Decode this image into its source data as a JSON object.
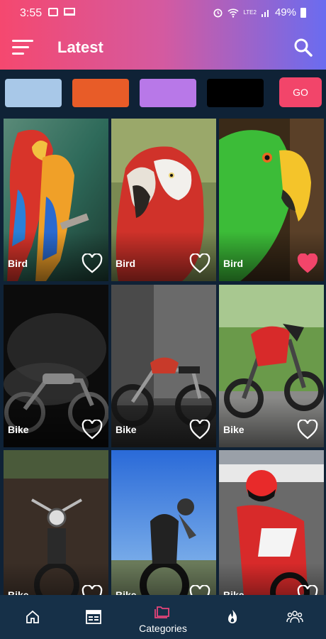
{
  "status_bar": {
    "time": "3:55",
    "battery": "49%",
    "network": "LTE2"
  },
  "header": {
    "title": "Latest"
  },
  "color_filter": {
    "swatches": [
      "#a8c8e8",
      "#e85c28",
      "#b878e8",
      "#000000"
    ],
    "go_label": "GO",
    "go_color": "#f2456a"
  },
  "wallpapers": [
    {
      "label": "Bird",
      "favorite": false
    },
    {
      "label": "Bird",
      "favorite": false
    },
    {
      "label": "Bird",
      "favorite": true
    },
    {
      "label": "Bike",
      "favorite": false
    },
    {
      "label": "Bike",
      "favorite": false
    },
    {
      "label": "Bike",
      "favorite": false
    },
    {
      "label": "Bike",
      "favorite": false
    },
    {
      "label": "Bike",
      "favorite": false
    },
    {
      "label": "Bike",
      "favorite": false
    }
  ],
  "bottom_nav": {
    "items": [
      {
        "icon": "home-icon",
        "label": ""
      },
      {
        "icon": "gallery-icon",
        "label": ""
      },
      {
        "icon": "folder-icon",
        "label": "Categories",
        "active": true
      },
      {
        "icon": "fire-icon",
        "label": ""
      },
      {
        "icon": "users-icon",
        "label": ""
      }
    ]
  },
  "colors": {
    "accent": "#f2456a",
    "nav_bg": "#163048",
    "page_bg": "#0f2236",
    "active_icon": "#e8457a"
  }
}
